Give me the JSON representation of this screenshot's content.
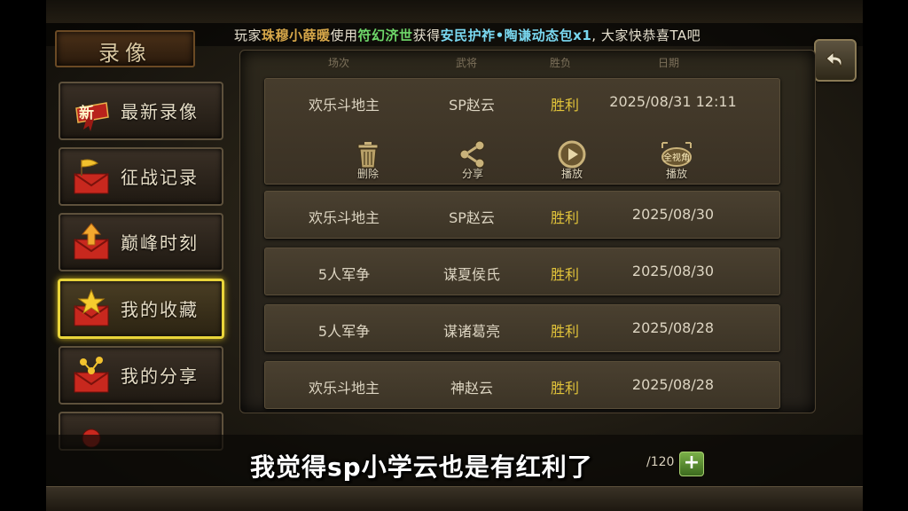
{
  "banner": {
    "prefix": "玩家",
    "player": "珠穆小薛暖",
    "mid1": "使用",
    "item": "符幻济世",
    "mid2": "获得",
    "reward": "安民护祚•陶谦动态包x1",
    "suffix": ", 大家快恭喜TA吧"
  },
  "title": "录像",
  "menu": [
    {
      "label": "最新录像",
      "badge": "新",
      "active": false
    },
    {
      "label": "征战记录",
      "active": false
    },
    {
      "label": "巅峰时刻",
      "active": false
    },
    {
      "label": "我的收藏",
      "active": true
    },
    {
      "label": "我的分享",
      "active": false
    }
  ],
  "headers": {
    "mode": "场次",
    "general": "武将",
    "result": "胜负",
    "date": "日期"
  },
  "records": [
    {
      "mode": "欢乐斗地主",
      "general": "SP赵云",
      "result": "胜利",
      "date": "2025/08/31  12:11"
    },
    {
      "mode": "欢乐斗地主",
      "general": "SP赵云",
      "result": "胜利",
      "date": "2025/08/30"
    },
    {
      "mode": "5人军争",
      "general": "谋夏侯氏",
      "result": "胜利",
      "date": "2025/08/30"
    },
    {
      "mode": "5人军争",
      "general": "谋诸葛亮",
      "result": "胜利",
      "date": "2025/08/28"
    },
    {
      "mode": "欢乐斗地主",
      "general": "神赵云",
      "result": "胜利",
      "date": "2025/08/28"
    }
  ],
  "actions": [
    {
      "label": "删除",
      "icon": "trash-icon"
    },
    {
      "label": "分享",
      "icon": "share-icon"
    },
    {
      "label": "播放",
      "icon": "play-icon"
    },
    {
      "label": "播放",
      "icon": "full-view-play-icon",
      "icon_text": "全视角"
    }
  ],
  "counter": "/120",
  "add_label": "+",
  "subtitle": "我觉得sp小学云也是有红利了",
  "colors": {
    "win": "#e2c43a",
    "highlight": "#e9d53a",
    "banner_player": "#d8a84a",
    "banner_item": "#6fd86a",
    "banner_reward": "#7ad8f0"
  }
}
